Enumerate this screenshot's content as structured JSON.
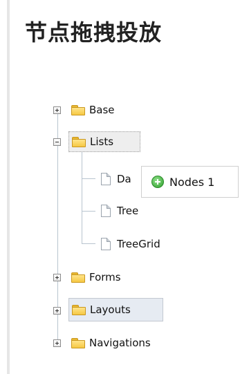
{
  "page": {
    "title": "节点拖拽投放"
  },
  "tree": {
    "nodes": [
      {
        "label": "Base",
        "type": "folder",
        "state": "collapsed"
      },
      {
        "label": "Lists",
        "type": "folder",
        "state": "expanded",
        "dragging": true,
        "children": [
          {
            "label": "Da",
            "type": "file"
          },
          {
            "label": "Tree",
            "type": "file"
          },
          {
            "label": "TreeGrid",
            "type": "file"
          }
        ]
      },
      {
        "label": "Forms",
        "type": "folder",
        "state": "collapsed"
      },
      {
        "label": "Layouts",
        "type": "folder",
        "state": "collapsed",
        "hovered": true
      },
      {
        "label": "Navigations",
        "type": "folder",
        "state": "collapsed"
      }
    ]
  },
  "drag_proxy": {
    "icon": "add-ok-icon",
    "label": "Nodes 1"
  },
  "colors": {
    "folder": "#f6c843",
    "tree_lines": "#b8c4cf",
    "hover_bg": "#e6ebf2",
    "drag_icon": "#2f9f2c"
  }
}
